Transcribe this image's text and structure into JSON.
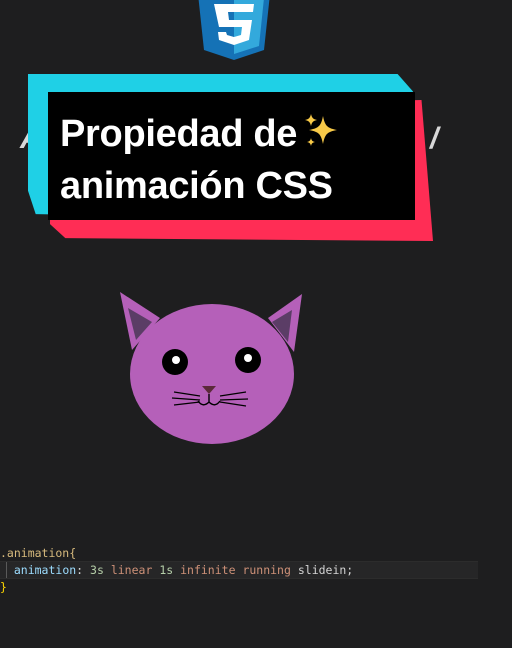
{
  "logo": {
    "name": "css3-shield-icon",
    "digit": "3"
  },
  "title": {
    "line1": "Propiedad de",
    "line2": "animación CSS",
    "emoji": "sparkles-icon",
    "bg_left": "A",
    "bg_right": "/"
  },
  "cat": {
    "color": "#b560b9",
    "ear_inner": "#5b3d66"
  },
  "code": {
    "line1_selector": ".animation{",
    "line2_property": "animation",
    "line2_colon": ": ",
    "line2_duration": "3s",
    "line2_timing": "linear",
    "line2_delay": "1s",
    "line2_iteration": "infinite",
    "line2_state": "running",
    "line2_name": "slidein;",
    "line3_close": "}"
  },
  "colors": {
    "background": "#1e1e1f",
    "cyan": "#1fd0e6",
    "red": "#ff2d55",
    "css_blue": "#2d6fd6"
  }
}
